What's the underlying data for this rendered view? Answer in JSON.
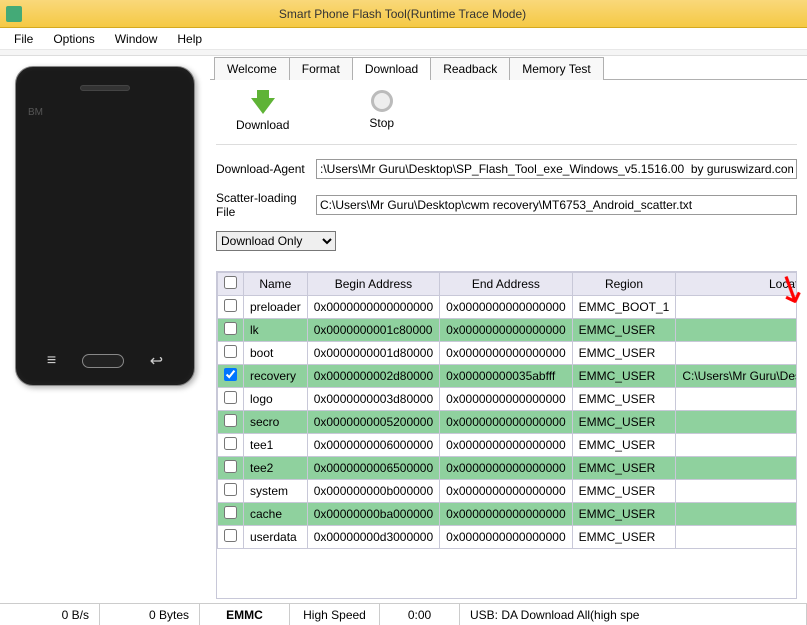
{
  "title": "Smart Phone Flash Tool(Runtime Trace Mode)",
  "menu": {
    "file": "File",
    "options": "Options",
    "window": "Window",
    "help": "Help"
  },
  "phone_brand": "BM",
  "tabs": {
    "welcome": "Welcome",
    "format": "Format",
    "download": "Download",
    "readback": "Readback",
    "memory_test": "Memory Test"
  },
  "buttons": {
    "download": "Download",
    "stop": "Stop"
  },
  "form": {
    "da_label": "Download-Agent",
    "da_value": ":\\Users\\Mr Guru\\Desktop\\SP_Flash_Tool_exe_Windows_v5.1516.00  by guruswizard.com\\MTK_AllInOne_DA.bin",
    "scatter_label": "Scatter-loading File",
    "scatter_value": "C:\\Users\\Mr Guru\\Desktop\\cwm recovery\\MT6753_Android_scatter.txt",
    "mode": "Download Only"
  },
  "columns": {
    "name": "Name",
    "begin": "Begin Address",
    "end": "End Address",
    "region": "Region",
    "location": "Location"
  },
  "rows": [
    {
      "chk": false,
      "green": false,
      "name": "preloader",
      "begin": "0x0000000000000000",
      "end": "0x0000000000000000",
      "region": "EMMC_BOOT_1",
      "loc": ""
    },
    {
      "chk": false,
      "green": true,
      "name": "lk",
      "begin": "0x0000000001c80000",
      "end": "0x0000000000000000",
      "region": "EMMC_USER",
      "loc": ""
    },
    {
      "chk": false,
      "green": false,
      "name": "boot",
      "begin": "0x0000000001d80000",
      "end": "0x0000000000000000",
      "region": "EMMC_USER",
      "loc": ""
    },
    {
      "chk": true,
      "green": true,
      "name": "recovery",
      "begin": "0x0000000002d80000",
      "end": "0x00000000035abfff",
      "region": "EMMC_USER",
      "loc": "C:\\Users\\Mr Guru\\Desktop\\cwm recovery"
    },
    {
      "chk": false,
      "green": false,
      "name": "logo",
      "begin": "0x0000000003d80000",
      "end": "0x0000000000000000",
      "region": "EMMC_USER",
      "loc": ""
    },
    {
      "chk": false,
      "green": true,
      "name": "secro",
      "begin": "0x0000000005200000",
      "end": "0x0000000000000000",
      "region": "EMMC_USER",
      "loc": ""
    },
    {
      "chk": false,
      "green": false,
      "name": "tee1",
      "begin": "0x0000000006000000",
      "end": "0x0000000000000000",
      "region": "EMMC_USER",
      "loc": ""
    },
    {
      "chk": false,
      "green": true,
      "name": "tee2",
      "begin": "0x0000000006500000",
      "end": "0x0000000000000000",
      "region": "EMMC_USER",
      "loc": ""
    },
    {
      "chk": false,
      "green": false,
      "name": "system",
      "begin": "0x000000000b000000",
      "end": "0x0000000000000000",
      "region": "EMMC_USER",
      "loc": ""
    },
    {
      "chk": false,
      "green": true,
      "name": "cache",
      "begin": "0x00000000ba000000",
      "end": "0x0000000000000000",
      "region": "EMMC_USER",
      "loc": ""
    },
    {
      "chk": false,
      "green": false,
      "name": "userdata",
      "begin": "0x00000000d3000000",
      "end": "0x0000000000000000",
      "region": "EMMC_USER",
      "loc": ""
    }
  ],
  "status": {
    "speed": "0 B/s",
    "bytes": "0 Bytes",
    "storage": "EMMC",
    "mode": "High Speed",
    "time": "0:00",
    "usb": "USB: DA Download All(high spe"
  }
}
